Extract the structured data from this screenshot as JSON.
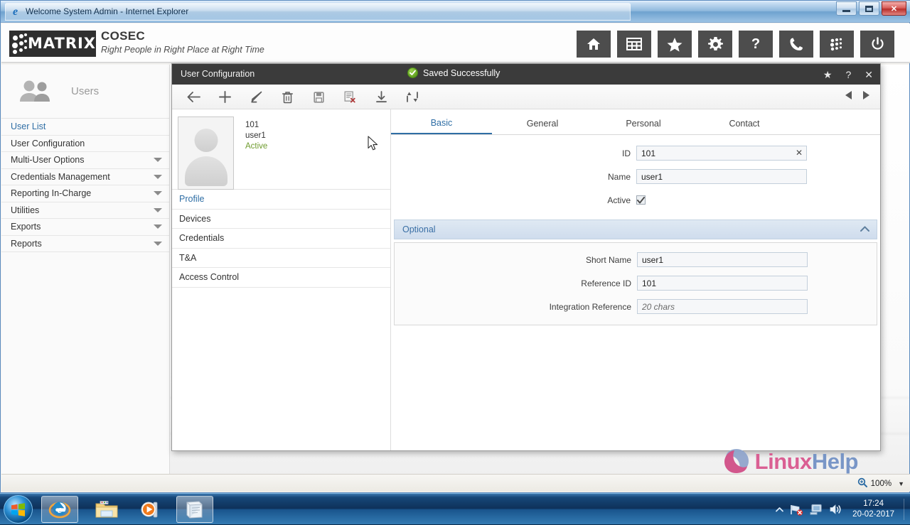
{
  "window": {
    "title": "Welcome System Admin - Internet Explorer",
    "icon": "internet-explorer-icon",
    "minimize_label": "Minimize",
    "maximize_label": "Maximize",
    "close_label": "Close"
  },
  "brand": {
    "logo_word": "MATRIX",
    "product": "COSEC",
    "tagline": "Right People in Right Place at Right Time",
    "header_icons": [
      {
        "name": "home-icon",
        "label": "Home"
      },
      {
        "name": "grid-icon",
        "label": "Dashboard"
      },
      {
        "name": "star-icon",
        "label": "Favourites"
      },
      {
        "name": "gear-icon",
        "label": "Settings"
      },
      {
        "name": "help-icon",
        "label": "Help"
      },
      {
        "name": "phone-icon",
        "label": "Support"
      },
      {
        "name": "matrix-dots-icon",
        "label": "Matrix"
      },
      {
        "name": "power-icon",
        "label": "Logout"
      }
    ]
  },
  "sidebar": {
    "header": "Users",
    "items": [
      {
        "label": "User List",
        "active": true,
        "expandable": false
      },
      {
        "label": "User Configuration",
        "active": false,
        "expandable": false
      },
      {
        "label": "Multi-User Options",
        "active": false,
        "expandable": true
      },
      {
        "label": "Credentials Management",
        "active": false,
        "expandable": true
      },
      {
        "label": "Reporting In-Charge",
        "active": false,
        "expandable": true
      },
      {
        "label": "Utilities",
        "active": false,
        "expandable": true
      },
      {
        "label": "Exports",
        "active": false,
        "expandable": true
      },
      {
        "label": "Reports",
        "active": false,
        "expandable": true
      }
    ]
  },
  "modal": {
    "title": "User Configuration",
    "status_message": "Saved Successfully",
    "titlebar_buttons": [
      {
        "name": "favourite-icon",
        "glyph": "★"
      },
      {
        "name": "help-icon",
        "glyph": "?"
      },
      {
        "name": "close-icon",
        "glyph": "✕"
      }
    ],
    "toolbar": [
      {
        "name": "back-icon",
        "label": "Back"
      },
      {
        "name": "add-icon",
        "label": "Add"
      },
      {
        "name": "edit-icon",
        "label": "Edit"
      },
      {
        "name": "delete-icon",
        "label": "Delete"
      },
      {
        "name": "save-icon",
        "label": "Save"
      },
      {
        "name": "export-icon",
        "label": "Export"
      },
      {
        "name": "download-icon",
        "label": "Download"
      },
      {
        "name": "sync-icon",
        "label": "Sync"
      }
    ],
    "nav_prev_label": "Previous",
    "nav_next_label": "Next"
  },
  "user_card": {
    "id": "101",
    "name": "user1",
    "status": "Active",
    "avatar": "user-avatar-placeholder"
  },
  "sections": [
    {
      "label": "Profile",
      "active": true
    },
    {
      "label": "Devices",
      "active": false
    },
    {
      "label": "Credentials",
      "active": false
    },
    {
      "label": "T&A",
      "active": false
    },
    {
      "label": "Access Control",
      "active": false
    }
  ],
  "tabs": [
    {
      "label": "Basic",
      "active": true
    },
    {
      "label": "General",
      "active": false
    },
    {
      "label": "Personal",
      "active": false
    },
    {
      "label": "Contact",
      "active": false
    }
  ],
  "form": {
    "id": {
      "label": "ID",
      "value": "101",
      "clear": "✕"
    },
    "name": {
      "label": "Name",
      "value": "user1"
    },
    "active": {
      "label": "Active",
      "checked": true
    }
  },
  "optional": {
    "title": "Optional",
    "collapse_glyph": "▲",
    "short_name": {
      "label": "Short Name",
      "value": "user1"
    },
    "reference_id": {
      "label": "Reference ID",
      "value": "101"
    },
    "integration_reference": {
      "label": "Integration Reference",
      "value": "",
      "placeholder": "20 chars"
    }
  },
  "status_bar": {
    "zoom": "100%",
    "zoom_icon": "zoom-magnifier-icon",
    "dropdown_glyph": "▼"
  },
  "watermark": {
    "linux": "Linux",
    "help": "Help"
  },
  "taskbar": {
    "start_label": "Start",
    "apps": [
      {
        "name": "taskbar-internet-explorer",
        "label": "Internet Explorer",
        "active": true
      },
      {
        "name": "taskbar-file-explorer",
        "label": "File Explorer",
        "active": false
      },
      {
        "name": "taskbar-media-player",
        "label": "Windows Media Player",
        "active": false
      },
      {
        "name": "taskbar-notepad",
        "label": "Sticky Notes",
        "active": true
      }
    ],
    "tray": {
      "show_hidden_glyph": "▲",
      "network_label": "Network",
      "display_label": "Display",
      "volume_label": "Volume",
      "time": "17:24",
      "date": "20-02-2017"
    }
  },
  "colors": {
    "accent_blue": "#2f6ea5",
    "header_dark": "#3b3b3b",
    "success_green": "#6f9c2e",
    "brand_dark": "#2f2f2f"
  }
}
